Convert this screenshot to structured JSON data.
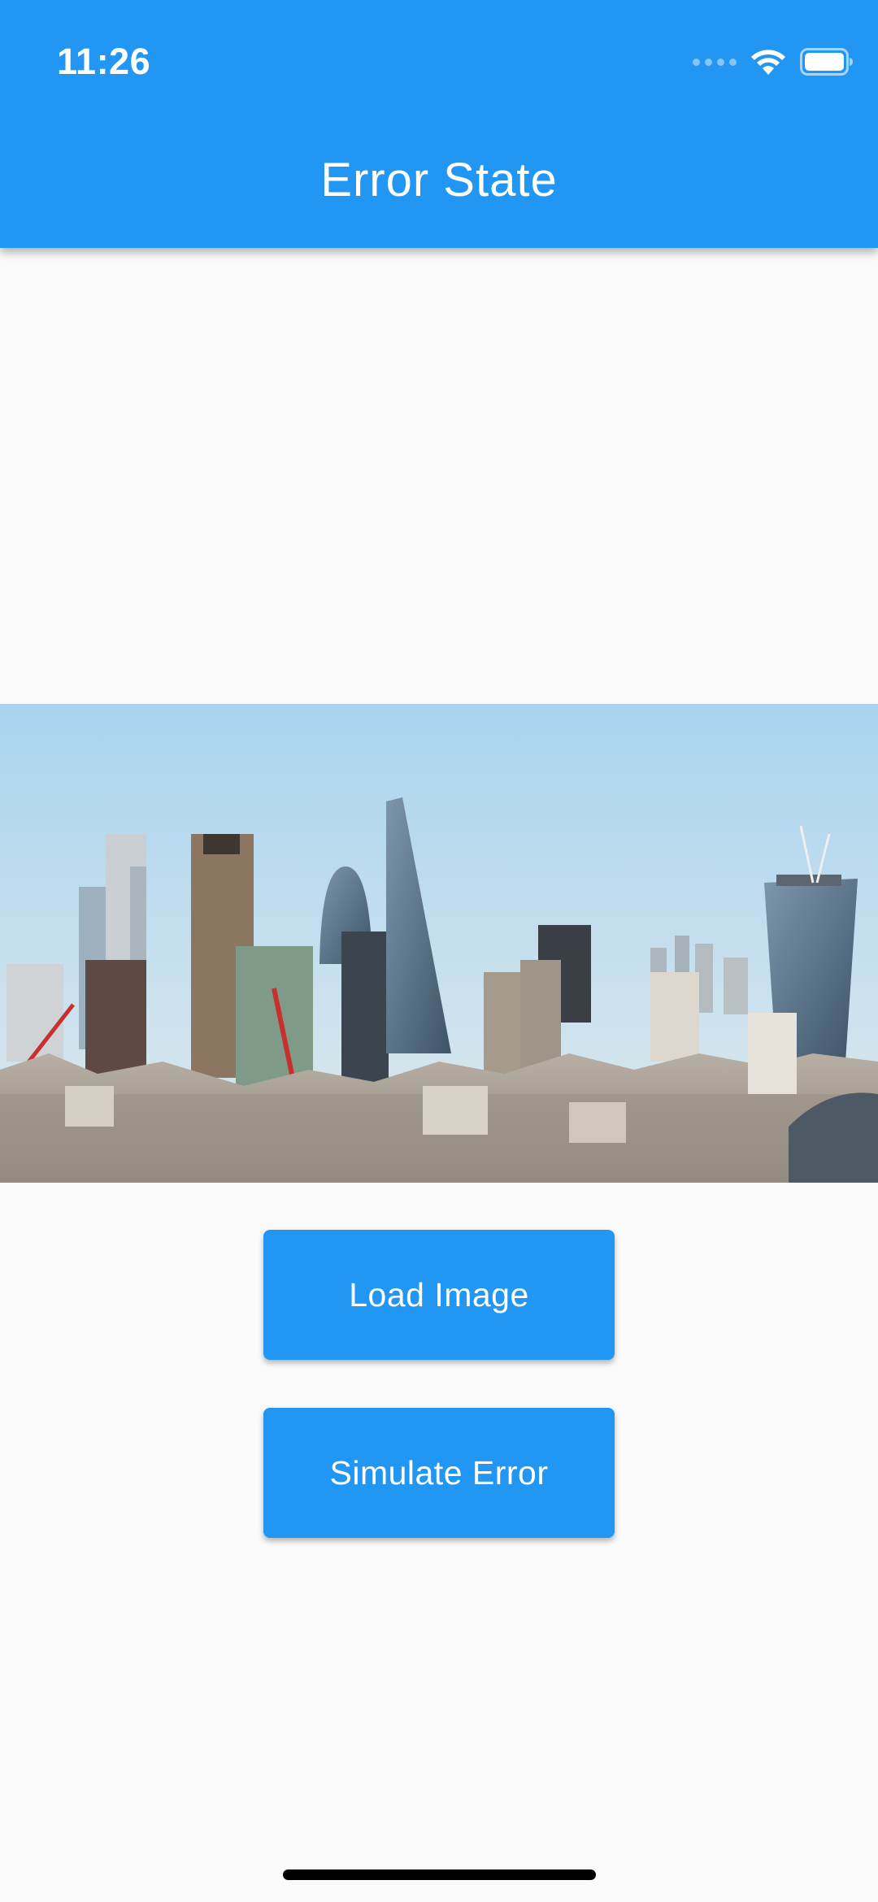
{
  "status_bar": {
    "time": "11:26",
    "icons": [
      "signal-icon",
      "wifi-icon",
      "battery-icon"
    ]
  },
  "app_bar": {
    "title": "Error State",
    "color": "#2196f3"
  },
  "image": {
    "description_icon": "city-skyline-photo"
  },
  "buttons": {
    "load_label": "Load Image",
    "error_label": "Simulate Error"
  },
  "colors": {
    "primary": "#2196f3",
    "background": "#fafafa",
    "text_on_primary": "#ffffff"
  }
}
